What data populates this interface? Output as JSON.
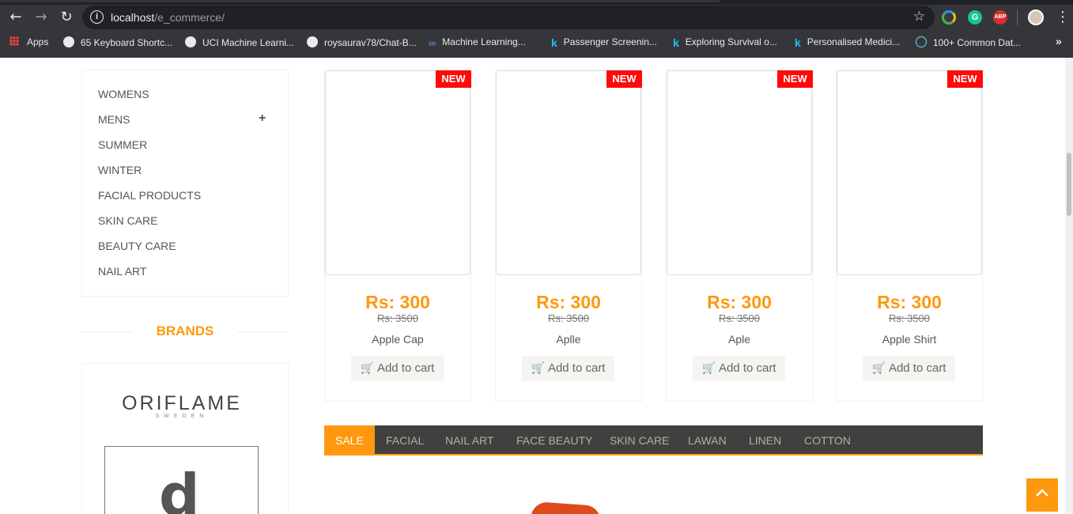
{
  "browser": {
    "url_host": "localhost",
    "url_path": "/e_commerce/",
    "bookmarks": [
      {
        "label": "Apps",
        "icon": "apps-grid-icon"
      },
      {
        "label": "65 Keyboard Shortc...",
        "icon": "globe-icon"
      },
      {
        "label": "UCI Machine Learni...",
        "icon": "globe-icon"
      },
      {
        "label": "roysaurav78/Chat-B...",
        "icon": "github-icon"
      },
      {
        "label": "Machine Learning...",
        "icon": "infinity-icon"
      },
      {
        "label": "Passenger Screenin...",
        "icon": "kaggle-icon"
      },
      {
        "label": "Exploring Survival o...",
        "icon": "kaggle-icon"
      },
      {
        "label": "Personalised Medici...",
        "icon": "kaggle-icon"
      },
      {
        "label": "100+ Common Dat...",
        "icon": "react-icon"
      }
    ],
    "extensions": {
      "grammarly": "G",
      "adblock": "ABP"
    },
    "more": "»"
  },
  "sidebar": {
    "categories": [
      "WOMENS",
      "MENS",
      "SUMMER",
      "WINTER",
      "FACIAL PRODUCTS",
      "SKIN CARE",
      "BEAUTY CARE",
      "NAIL ART"
    ],
    "expand_symbol": "+",
    "brands_title": "BRANDS",
    "brand_logo_text": "ORIFLAME",
    "brand_logo_sub": "SWEDEN",
    "brand_glyph": "d"
  },
  "products": [
    {
      "badge": "NEW",
      "price": "Rs: 300",
      "old_price": "Rs: 3500",
      "name": "Apple Cap",
      "cart_label": "Add to cart"
    },
    {
      "badge": "NEW",
      "price": "Rs: 300",
      "old_price": "Rs: 3500",
      "name": "Aplle",
      "cart_label": "Add to cart"
    },
    {
      "badge": "NEW",
      "price": "Rs: 300",
      "old_price": "Rs: 3500",
      "name": "Aple",
      "cart_label": "Add to cart"
    },
    {
      "badge": "NEW",
      "price": "Rs: 300",
      "old_price": "Rs: 3500",
      "name": "Apple Shirt",
      "cart_label": "Add to cart"
    }
  ],
  "tabs": [
    "SALE",
    "FACIAL",
    "NAIL ART",
    "FACE BEAUTY",
    "SKIN CARE",
    "LAWAN",
    "LINEN",
    "COTTON"
  ],
  "colors": {
    "accent": "#fe980f",
    "badge": "#fe0a0a",
    "tabbar": "#40403e"
  }
}
